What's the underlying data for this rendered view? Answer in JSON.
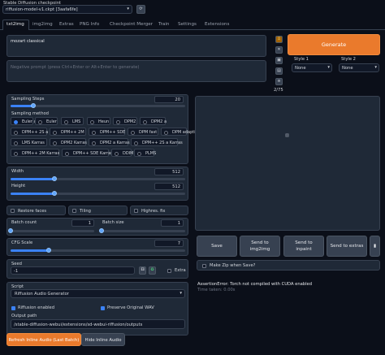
{
  "header": {
    "checkpoint_label": "Stable Diffusion checkpoint",
    "checkpoint_value": "riffusion-model-v1.ckpt [3aafa6fe]",
    "refresh_icon": "refresh-icon"
  },
  "tabs": [
    "txt2img",
    "img2img",
    "Extras",
    "PNG Info",
    "Checkpoint Merger",
    "Train",
    "Settings",
    "Extensions"
  ],
  "active_tab": "txt2img",
  "prompt": {
    "value": "mozart classical",
    "negative_placeholder": "Negative prompt (press Ctrl+Enter or Alt+Enter to generate)",
    "token_count": "2/75"
  },
  "generate": {
    "label": "Generate",
    "style1_label": "Style 1",
    "style1_value": "None",
    "style2_label": "Style 2",
    "style2_value": "None"
  },
  "sampling": {
    "steps_label": "Sampling Steps",
    "steps_value": "20",
    "steps_fraction": 0.13,
    "method_label": "Sampling method",
    "methods": [
      "Euler a",
      "Euler",
      "LMS",
      "Heun",
      "DPM2",
      "DPM2 a",
      "DPM++ 2S a",
      "DPM++ 2M",
      "DPM++ SDE",
      "DPM fast",
      "DPM adaptive",
      "LMS Karras",
      "DPM2 Karras",
      "DPM2 a Karras",
      "DPM++ 2S a Karras",
      "DPM++ 2M Karras",
      "DPM++ SDE Karras",
      "DDIM",
      "PLMS"
    ],
    "selected": "Euler a"
  },
  "size": {
    "width_label": "Width",
    "width_value": "512",
    "width_fraction": 0.25,
    "height_label": "Height",
    "height_value": "512",
    "height_fraction": 0.25
  },
  "options": {
    "restore_faces": "Restore faces",
    "tiling": "Tiling",
    "highres": "Highres. fix"
  },
  "batch": {
    "count_label": "Batch count",
    "count_value": "1",
    "count_fraction": 0.0,
    "size_label": "Batch size",
    "size_value": "1",
    "size_fraction": 0.0
  },
  "cfg": {
    "label": "CFG Scale",
    "value": "7",
    "fraction": 0.22
  },
  "seed": {
    "label": "Seed",
    "value": "-1",
    "extra_label": "Extra",
    "dice_icon": "dice-icon",
    "recycle_icon": "recycle-icon"
  },
  "script": {
    "label": "Script",
    "value": "Riffusion Audio Generator",
    "riffusion_enabled": "Riffusion enabled",
    "preserve_wav": "Preserve Original WAV",
    "output_path_label": "Output path",
    "output_path_value": "/stable-diffusion-webui/extensions/sd-webui-riffusion/outputs"
  },
  "audio_buttons": {
    "refresh": "Refresh Inline Audio (Last Batch)",
    "hide": "Hide Inline Audio"
  },
  "actions": {
    "save": "Save",
    "send_img2img": "Send to img2img",
    "send_inpaint": "Send to inpaint",
    "send_extras": "Send to extras",
    "make_zip": "Make Zip when Save?"
  },
  "output": {
    "error": "AssertionError: Torch not compiled with CUDA enabled",
    "time": "Time taken: 0.00s"
  },
  "colors": {
    "accent": "#ea7a2c",
    "background": "#0b0f19",
    "panel": "#1f2937",
    "slider": "#3b82f6"
  }
}
